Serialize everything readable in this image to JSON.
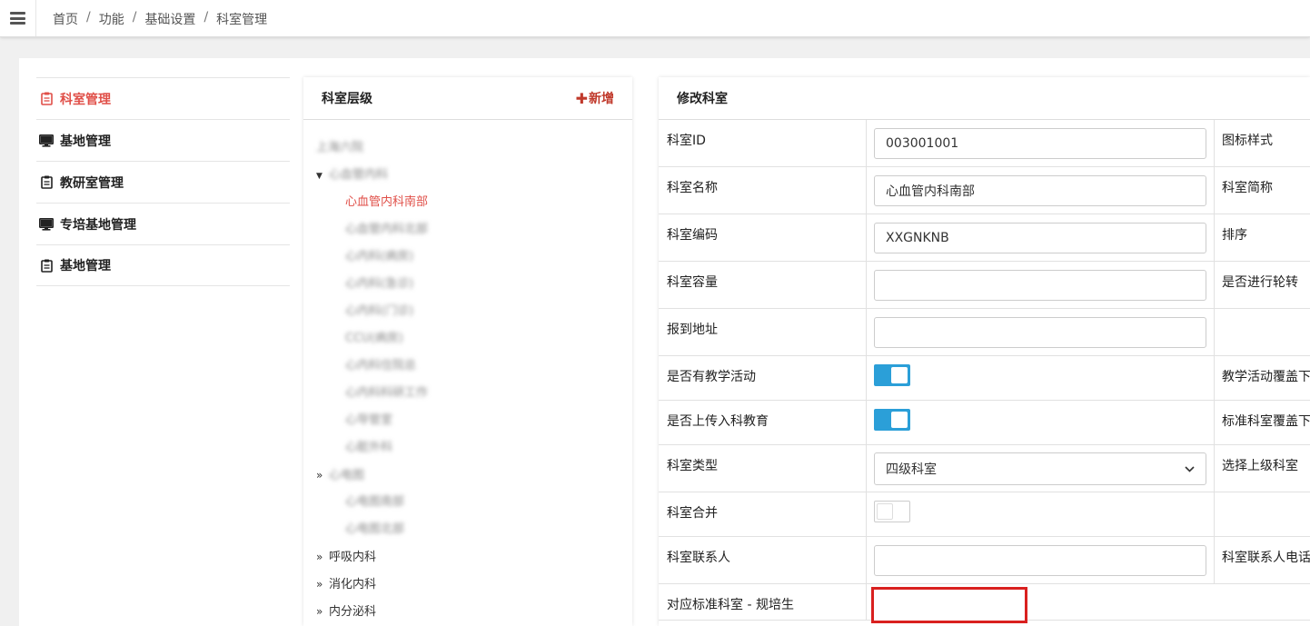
{
  "breadcrumb": [
    "首页",
    "功能",
    "基础设置",
    "科室管理"
  ],
  "colors": {
    "accent_red": "#e04f48",
    "toggle_blue": "#2b9fd8",
    "highlight_red": "#d9201f"
  },
  "leftnav": [
    {
      "label": "科室管理",
      "icon": "clipboard-icon",
      "active": true
    },
    {
      "label": "基地管理",
      "icon": "monitor-icon",
      "active": false
    },
    {
      "label": "教研室管理",
      "icon": "clipboard-icon",
      "active": false
    },
    {
      "label": "专培基地管理",
      "icon": "monitor-icon",
      "active": false
    },
    {
      "label": "基地管理",
      "icon": "clipboard-icon",
      "active": false
    }
  ],
  "tree_panel": {
    "title": "科室层级",
    "add_label": "新增",
    "items": [
      {
        "label": "上海六院",
        "level": 0,
        "blurred": true,
        "arrow": ""
      },
      {
        "label": "心血管内科",
        "level": 0,
        "blurred": true,
        "arrow": "▼"
      },
      {
        "label": "心血管内科南部",
        "level": 1,
        "blurred": false,
        "selected": true,
        "arrow": ""
      },
      {
        "label": "心血管内科北部",
        "level": 1,
        "blurred": true,
        "arrow": ""
      },
      {
        "label": "心内科(病房)",
        "level": 1,
        "blurred": true,
        "arrow": ""
      },
      {
        "label": "心内科(急诊)",
        "level": 1,
        "blurred": true,
        "arrow": ""
      },
      {
        "label": "心内科(门诊)",
        "level": 1,
        "blurred": true,
        "arrow": ""
      },
      {
        "label": "CCU(病房)",
        "level": 1,
        "blurred": true,
        "arrow": ""
      },
      {
        "label": "心内科住院总",
        "level": 1,
        "blurred": true,
        "arrow": ""
      },
      {
        "label": "心内科科研工作",
        "level": 1,
        "blurred": true,
        "arrow": ""
      },
      {
        "label": "心导管室",
        "level": 1,
        "blurred": true,
        "arrow": ""
      },
      {
        "label": "心脏外科",
        "level": 1,
        "blurred": true,
        "arrow": ""
      },
      {
        "label": "心电图",
        "level": 0,
        "blurred": true,
        "arrow": "»"
      },
      {
        "label": "心电图南部",
        "level": 1,
        "blurred": true,
        "arrow": ""
      },
      {
        "label": "心电图北部",
        "level": 1,
        "blurred": true,
        "arrow": ""
      },
      {
        "label": "呼吸内科",
        "level": 0,
        "blurred": false,
        "arrow": "»"
      },
      {
        "label": "消化内科",
        "level": 0,
        "blurred": false,
        "arrow": "»"
      },
      {
        "label": "内分泌科",
        "level": 0,
        "blurred": false,
        "arrow": "»"
      }
    ]
  },
  "form": {
    "title": "修改科室",
    "rows": [
      {
        "label": "科室ID",
        "type": "input",
        "value": "003001001",
        "label2": "图标样式"
      },
      {
        "label": "科室名称",
        "type": "input",
        "value": "心血管内科南部",
        "label2": "科室简称"
      },
      {
        "label": "科室编码",
        "type": "input",
        "value": "XXGNKNB",
        "label2": "排序"
      },
      {
        "label": "科室容量",
        "type": "input",
        "value": "",
        "label2": "是否进行轮转"
      },
      {
        "label": "报到地址",
        "type": "input",
        "value": "",
        "label2": ""
      },
      {
        "label": "是否有教学活动",
        "type": "toggle",
        "on": true,
        "label2": "教学活动覆盖下"
      },
      {
        "label": "是否上传入科教育",
        "type": "toggle",
        "on": true,
        "label2": "标准科室覆盖下"
      },
      {
        "label": "科室类型",
        "type": "select",
        "value": "四级科室",
        "label2": "选择上级科室"
      },
      {
        "label": "科室合并",
        "type": "toggle",
        "on": false,
        "label2": ""
      },
      {
        "label": "科室联系人",
        "type": "input",
        "value": "",
        "label2": "科室联系人电话"
      },
      {
        "label": "对应标准科室 - 规培生",
        "type": "highlight",
        "value": "",
        "label2": ""
      }
    ]
  }
}
